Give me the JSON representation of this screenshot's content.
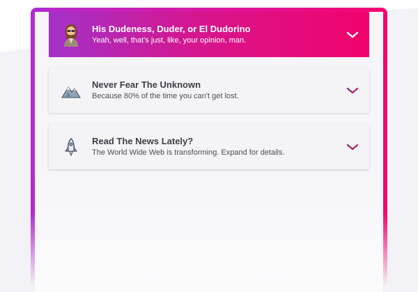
{
  "accordion": {
    "items": [
      {
        "title": "His Dudeness, Duder, or El Dudorino",
        "subtitle": "Yeah, well, that's just, like, your opinion, man.",
        "icon": "dude-avatar-icon",
        "expanded": true
      },
      {
        "title": "Never Fear The Unknown",
        "subtitle": "Because 80% of the time you can't get lost.",
        "icon": "mountain-icon",
        "expanded": false
      },
      {
        "title": "Read The News Lately?",
        "subtitle": "The World Wide Web is transforming. Expand for details.",
        "icon": "rocket-icon",
        "expanded": false
      }
    ]
  },
  "colors": {
    "accent_start": "#a331c9",
    "accent_end": "#f1036c",
    "chevron": "#7b2a6a"
  }
}
